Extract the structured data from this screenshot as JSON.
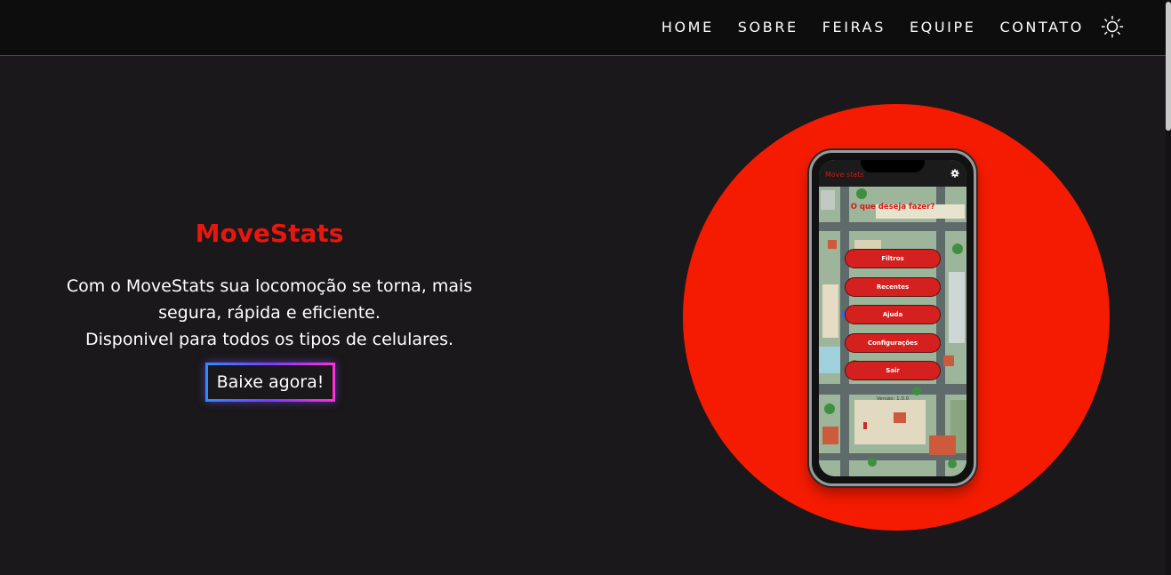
{
  "nav": {
    "links": [
      "HOME",
      "SOBRE",
      "FEIRAS",
      "EQUIPE",
      "CONTATO"
    ],
    "theme_icon": "sun-icon"
  },
  "hero": {
    "title": "MoveStats",
    "description_lines": [
      "Com o MoveStats sua locomoção se torna, mais",
      "segura, rápida e eficiente.",
      "Disponivel para todos os tipos de celulares."
    ],
    "cta": "Baixe agora!"
  },
  "phone_app": {
    "title": "Move stats",
    "question": "O que deseja fazer?",
    "menu": [
      "Filtros",
      "Recentes",
      "Ajuda",
      "Configurações",
      "Sair"
    ],
    "version": "Versão: 1.0.0",
    "settings_icon": "gear-icon"
  },
  "colors": {
    "accent": "#e8170e",
    "background": "#1a181a",
    "navbar": "#0d0d0d",
    "circle": "#f41b00"
  }
}
